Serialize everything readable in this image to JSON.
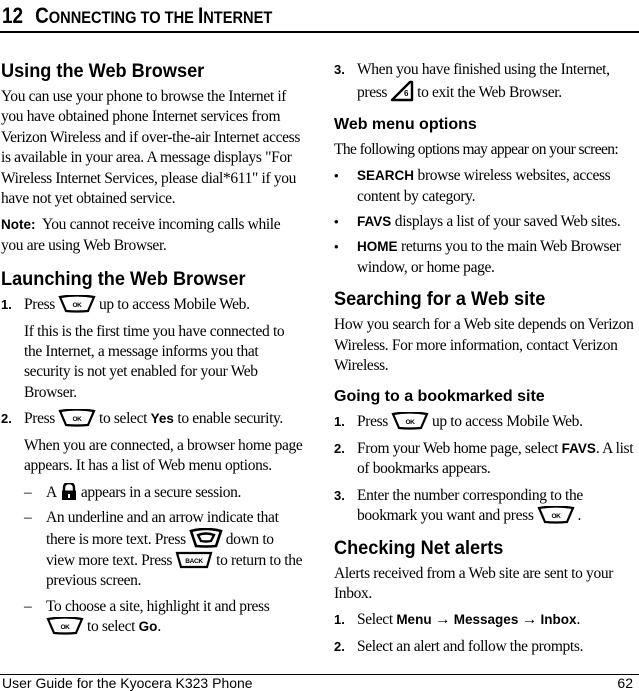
{
  "header": {
    "chapter_number": "12",
    "chapter_title_parts": [
      {
        "cap": "C",
        "rest": "ONNECTING"
      },
      {
        "cap": "",
        "rest": " TO THE "
      },
      {
        "cap": "I",
        "rest": "NTERNET"
      }
    ]
  },
  "left_column": {
    "using_heading": "Using the Web Browser",
    "using_body": "You can use your phone to browse the Internet if you have obtained phone Internet services from Verizon Wireless and if over-the-air Internet access is available in your area. A message displays \"For Wireless Internet Services, please dial*611\" if you have not yet obtained service.",
    "note_label": "Note:",
    "note_text": "You cannot receive incoming calls while you are using Web Browser.",
    "launching_heading": "Launching the Web Browser",
    "launch_steps": [
      {
        "num": "1.",
        "pre": "Press",
        "key_icon": "ok-key-icon",
        "post": "up to access Mobile Web.",
        "continuation": "If this is the first time you have connected to the Internet, a message informs you that security is not yet enabled for your Web Browser."
      },
      {
        "num": "2.",
        "pre": "Press",
        "key_icon": "ok-key-icon",
        "mid": "to select",
        "bold": "Yes",
        "post": "to enable security.",
        "continuation": "When you are connected, a browser home page appears. It has a list of Web menu options.",
        "sub_items": [
          {
            "dash": "–",
            "pre": "A",
            "icon": "lock-icon",
            "post": "appears in a secure session."
          },
          {
            "dash": "–",
            "pre": "An underline and an arrow indicate that there is more text. Press",
            "icon": "navigation-down-key-icon",
            "mid": "down to view more text. Press",
            "icon2": "back-key-icon",
            "post": "to return to the previous screen."
          },
          {
            "dash": "–",
            "pre": "To choose a site, highlight it and press",
            "icon": "ok-key-icon",
            "mid": "to select",
            "bold": "Go",
            "post": "."
          }
        ]
      }
    ]
  },
  "right_column": {
    "step3": {
      "num": "3.",
      "pre": "When you have finished using the Internet, press",
      "key_icon": "end-key-icon",
      "post": "to exit the Web Browser."
    },
    "web_menu_heading": "Web menu options",
    "web_menu_intro": "The following options may appear on your screen:",
    "web_menu_items": [
      {
        "bullet": "•",
        "label": "SEARCH",
        "text": "browse wireless websites, access content by category."
      },
      {
        "bullet": "•",
        "label": "FAVS",
        "text": "displays a list of your saved Web sites."
      },
      {
        "bullet": "•",
        "label": "HOME",
        "text": "returns you to the main Web Browser window, or home page."
      }
    ],
    "searching_heading": "Searching for a Web site",
    "searching_body": "How you search for a Web site depends on Verizon Wireless. For more information, contact Verizon Wireless.",
    "bookmark_heading": "Going to a bookmarked site",
    "bookmark_steps": [
      {
        "num": "1.",
        "pre": "Press",
        "key_icon": "ok-key-icon",
        "post": "up to access Mobile Web."
      },
      {
        "num": "2.",
        "pre": "From your Web home page, select",
        "bold": "FAVS",
        "post": ". A list of bookmarks appears."
      },
      {
        "num": "3.",
        "pre": "Enter the number corresponding to the bookmark you want and press",
        "key_icon": "ok-key-icon",
        "post": "."
      }
    ],
    "alerts_heading": "Checking Net alerts",
    "alerts_body": "Alerts received from a Web site are sent to your Inbox.",
    "alerts_steps": [
      {
        "num": "1.",
        "pre": "Select",
        "path": [
          "Menu",
          "Messages",
          "Inbox"
        ],
        "arrow": "→",
        "post": "."
      },
      {
        "num": "2.",
        "pre": "Select an alert and follow the prompts."
      }
    ]
  },
  "footer": {
    "guide_title": "User Guide for the Kyocera K323 Phone",
    "page_number": "62"
  },
  "key_labels": {
    "ok": "OK",
    "back": "BACK",
    "end": "6"
  }
}
